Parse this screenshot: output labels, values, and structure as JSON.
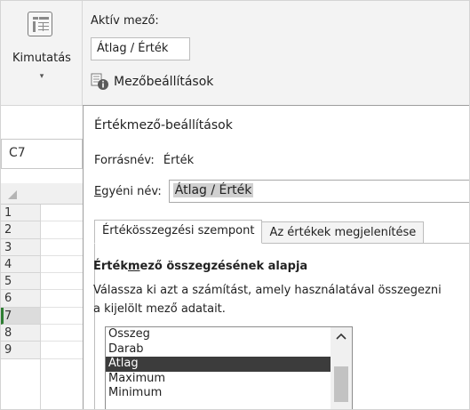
{
  "ribbon": {
    "pivot_label": "Kimutatás",
    "pivot_caret": "▾",
    "active_field_label": "Aktív mező:",
    "active_field_value": "Átlag / Érték",
    "field_settings_label": "Mezőbeállítások"
  },
  "grid": {
    "name_box": "C7",
    "rows": [
      "1",
      "2",
      "3",
      "4",
      "5",
      "6",
      "7",
      "8",
      "9"
    ],
    "selected_row": "7"
  },
  "dialog": {
    "title": "Értékmező-beállítások",
    "source_label": "Forrásnév:",
    "source_value": "Érték",
    "custom_name_label": "Egyéni név:",
    "custom_name_value": "Átlag / Érték",
    "tabs": [
      {
        "label": "Értékösszegzési szempont",
        "active": true
      },
      {
        "label": "Az értékek megjelenítése",
        "active": false
      }
    ],
    "summary_heading": "Értékmező összegzésének alapja",
    "summary_desc_line1": "Válassza ki azt a számítást, amely használatával összegezni",
    "summary_desc_line2": "a kijelölt mező adatait.",
    "list_items": [
      "Összeg",
      "Darab",
      "Átlag",
      "Maximum",
      "Minimum"
    ],
    "selected_item": "Átlag"
  },
  "colors": {
    "selection_bg": "#3c3c3c",
    "ribbon_bg": "#f3f3f3",
    "row_selected_marker": "#2e7d32"
  }
}
